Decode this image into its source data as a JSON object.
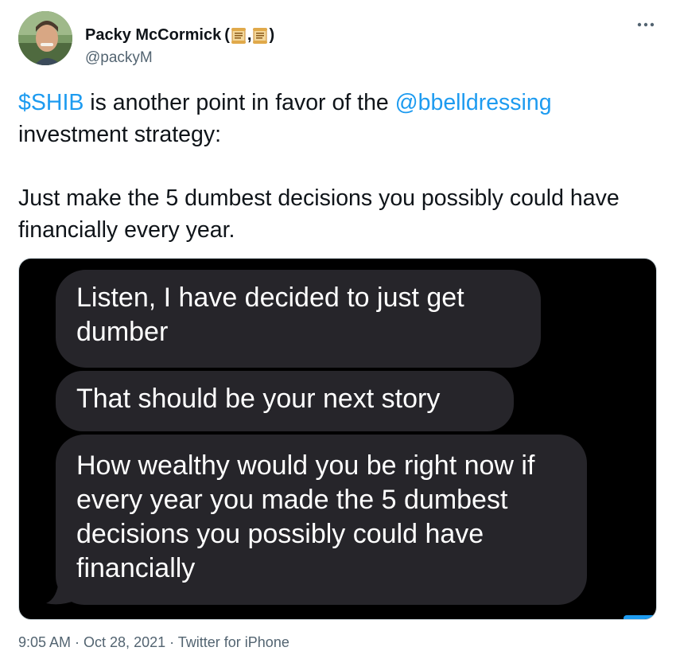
{
  "author": {
    "display_name": "Packy McCormick",
    "name_suffix_open": "(",
    "name_suffix_sep": ",",
    "name_suffix_close": ")",
    "emoji_icon": "scroll-icon",
    "handle": "@packyM"
  },
  "more_icon": "more-horizontal-icon",
  "tweet": {
    "cashtag": "$SHIB",
    "text_1": " is another point in favor of the ",
    "mention": "@bbelldressing",
    "text_2": " investment strategy:",
    "paragraph_2": "Just make the 5 dumbest decisions you possibly could have financially every year."
  },
  "media": {
    "messages": [
      "Listen, I have decided to just get dumber",
      "That should be your next story",
      "How wealthy would you be right now if every year you made the 5 dumbest decisions you possibly could have financially"
    ]
  },
  "colors": {
    "link": "#1d9bf0",
    "bubble": "#26252a",
    "media_background": "#000000",
    "secondary_text": "#536471"
  },
  "footer": {
    "timestamp_partial": "9:05 AM · Oct 28, 2021 · Twitter for iPhone"
  }
}
